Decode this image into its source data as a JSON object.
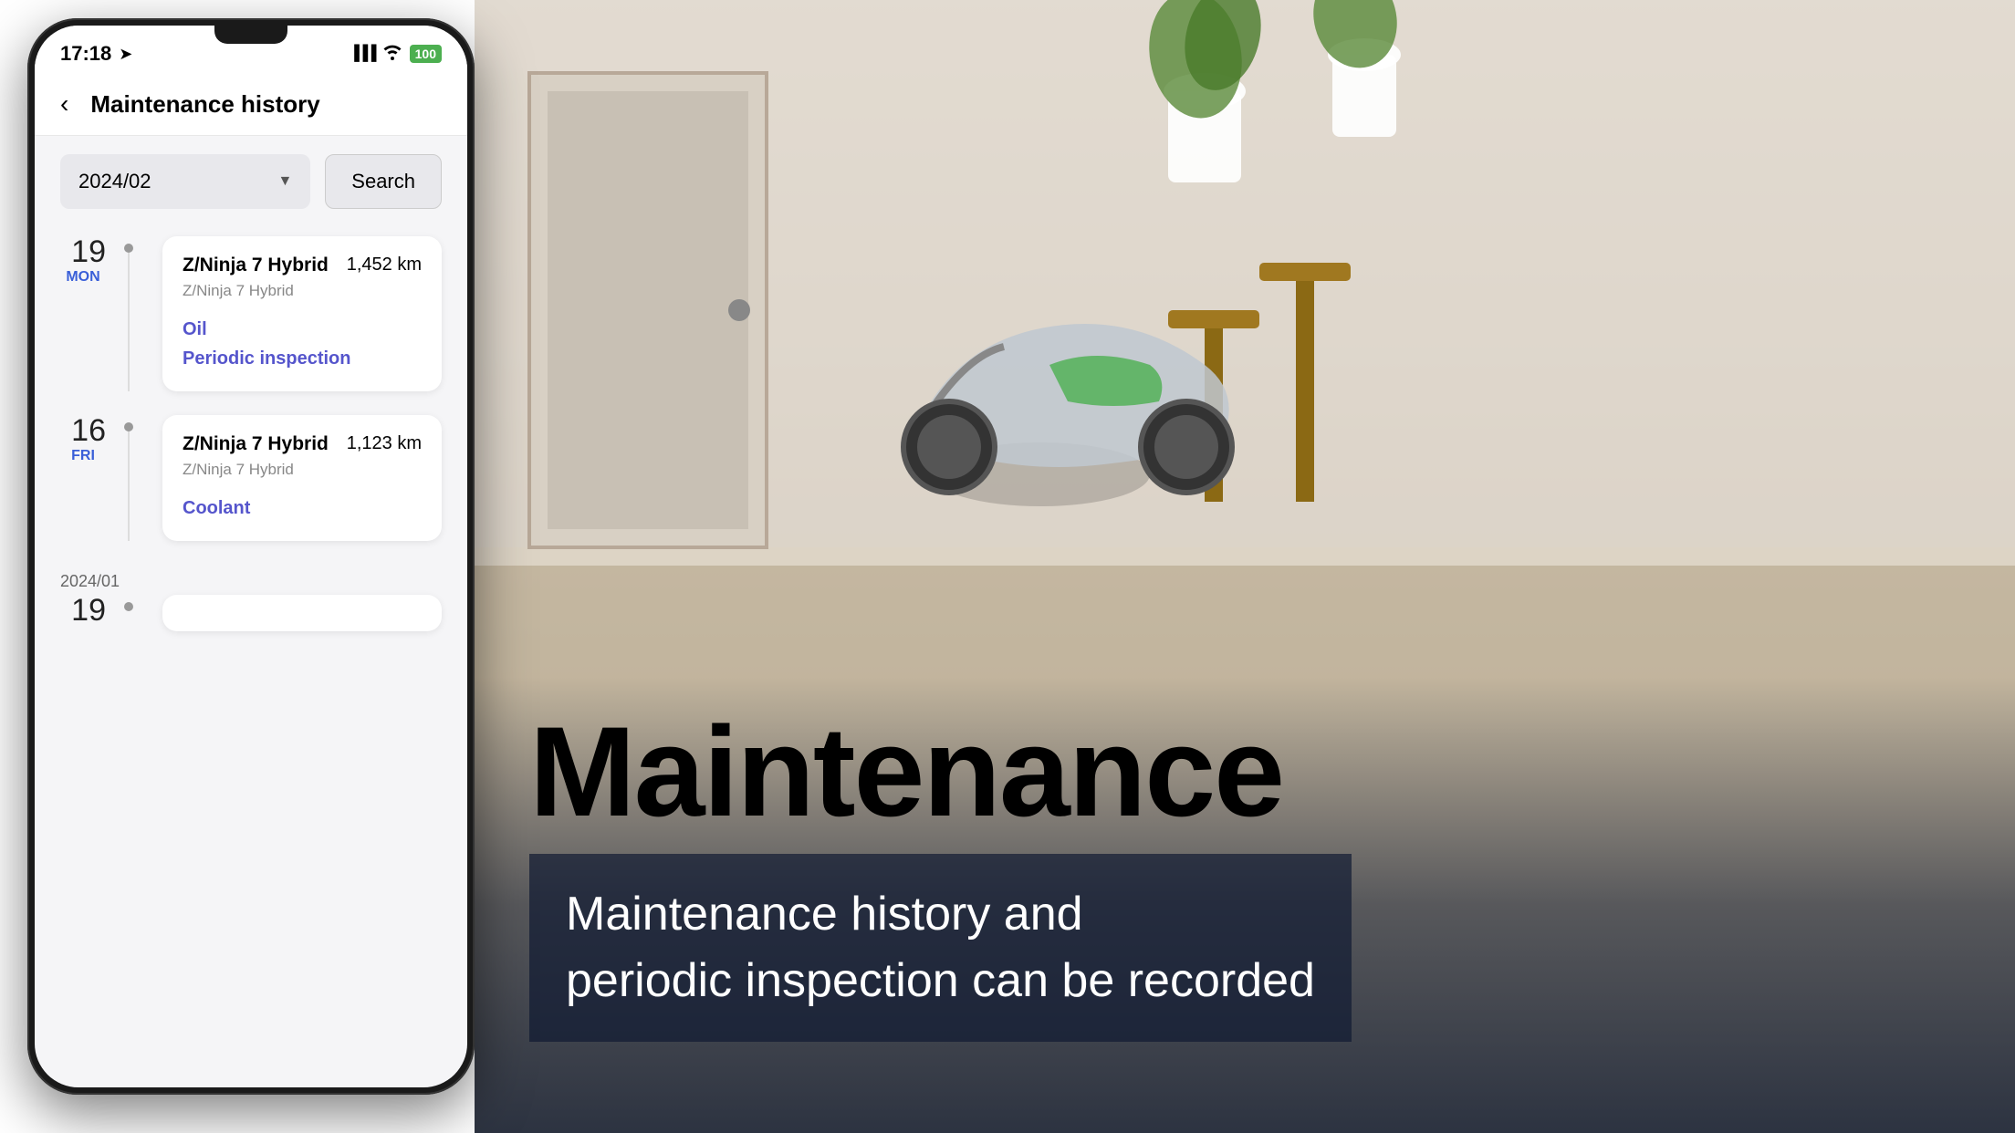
{
  "background": {
    "color_from": "#c8d4dc",
    "color_to": "#2a4050"
  },
  "overlay_text": {
    "title": "Maintenance",
    "subtitle": "Maintenance history and\nperiodic inspection can be recorded"
  },
  "phone": {
    "status_bar": {
      "time": "17:18",
      "navigation_icon": "➤",
      "signal_icon": "▐▐▐",
      "wifi_icon": "📶",
      "battery_label": "100"
    },
    "header": {
      "back_label": "‹",
      "title": "Maintenance history"
    },
    "filter": {
      "date_value": "2024/02",
      "dropdown_arrow": "▼",
      "search_label": "Search"
    },
    "entries": [
      {
        "day_number": "19",
        "day_name": "MON",
        "model_name": "Z/Ninja 7 Hybrid",
        "model_sub": "Z/Ninja 7 Hybrid",
        "km": "1,452 km",
        "services": [
          "Oil",
          "Periodic inspection"
        ]
      },
      {
        "day_number": "16",
        "day_name": "FRI",
        "model_name": "Z/Ninja 7 Hybrid",
        "model_sub": "Z/Ninja 7 Hybrid",
        "km": "1,123 km",
        "services": [
          "Coolant"
        ]
      }
    ],
    "year_label": "2024/01",
    "next_day": "19"
  }
}
